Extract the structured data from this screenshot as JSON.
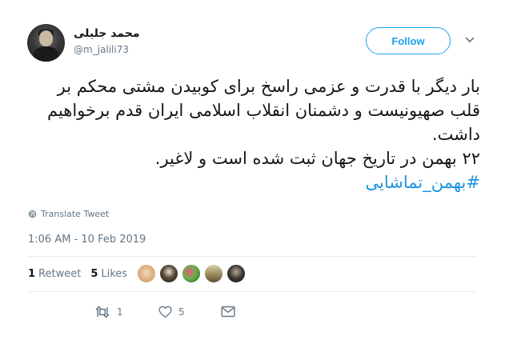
{
  "user": {
    "display_name": "محمد جلیلی",
    "handle": "@m_jalili73"
  },
  "follow_label": "Follow",
  "tweet": {
    "lines": [
      "بار دیگر با قدرت و عزمی راسخ برای کوبیدن مشتی محکم بر",
      "قلب صهیونیست و دشمنان انقلاب اسلامی ایران قدم برخواهیم",
      "داشت.",
      "۲۲ بهمن در تاریخ جهان ثبت شده است و لاغیر."
    ],
    "hashtag": "#بهمن_تماشایی"
  },
  "translate_label": "Translate Tweet",
  "timestamp": "1:06 AM - 10 Feb 2019",
  "stats": {
    "retweets_count": "1",
    "retweets_label": "Retweet",
    "likes_count": "5",
    "likes_label": "Likes"
  },
  "actions": {
    "retweet_count": "1",
    "like_count": "5"
  },
  "icons": [
    "chevron-down-icon",
    "globe-icon",
    "reply-icon",
    "retweet-icon",
    "like-icon",
    "dm-icon"
  ],
  "colors": {
    "accent": "#1da1f2",
    "link": "#1b95e0",
    "muted": "#657786",
    "text": "#14171a",
    "divider": "#e6ecf0"
  }
}
